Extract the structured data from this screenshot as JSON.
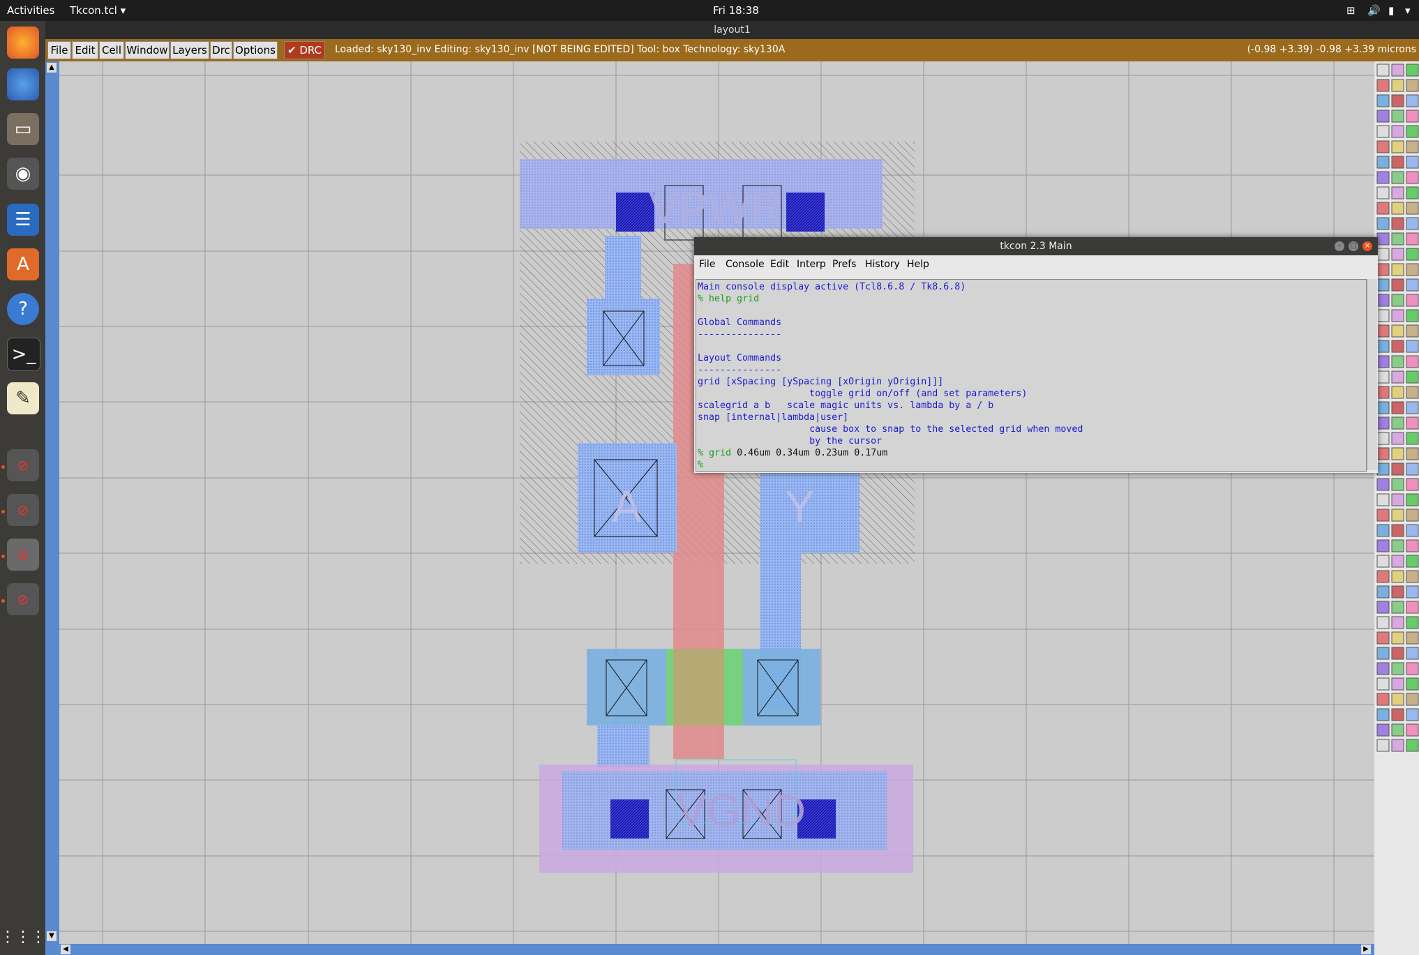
{
  "topbar": {
    "activities": "Activities",
    "app_menu": "Tkcon.tcl ▾",
    "clock": "Fri 18:38"
  },
  "window": {
    "title": "layout1"
  },
  "menubar": {
    "items": [
      "File",
      "Edit",
      "Cell",
      "Window",
      "Layers",
      "Drc",
      "Options"
    ],
    "drc_toggle": "✔ DRC",
    "status": "Loaded: sky130_inv Editing: sky130_inv [NOT BEING EDITED] Tool: box  Technology: sky130A",
    "coords": "(-0.98 +3.39) -0.98 +3.39 microns"
  },
  "layout": {
    "labels": {
      "vpwr": "VPWR",
      "vgnd": "VGND",
      "a": "A",
      "y": "Y"
    }
  },
  "tkcon": {
    "title": "tkcon 2.3 Main",
    "menu": [
      "File",
      "Console",
      "Edit",
      "Interp",
      "Prefs",
      "History",
      "Help"
    ],
    "lines": {
      "l1": "Main console display active (Tcl8.6.8 / Tk8.6.8)",
      "l2_prompt": "%",
      "l2_cmd": "help grid",
      "l3": "Global Commands",
      "l4": "---------------",
      "l5": "Layout Commands",
      "l6": "---------------",
      "l7": "grid [xSpacing [ySpacing [xOrigin yOrigin]]]",
      "l8": "                    toggle grid on/off (and set parameters)",
      "l9": "scalegrid a b   scale magic units vs. lambda by a / b",
      "l10": "snap [internal|lambda|user]",
      "l11": "                    cause box to snap to the selected grid when moved",
      "l12": "                    by the cursor",
      "l13_prompt": "%",
      "l13_cmd": "grid",
      "l13_args": "0.46um 0.34um 0.23um 0.17um",
      "l14_prompt": "%"
    }
  },
  "colors": {
    "menubar": "#9c6a1c",
    "canvas": "#cccccc",
    "poly": "#e08a8a",
    "metal1": "#9a9aff",
    "diff": "#77d477"
  }
}
